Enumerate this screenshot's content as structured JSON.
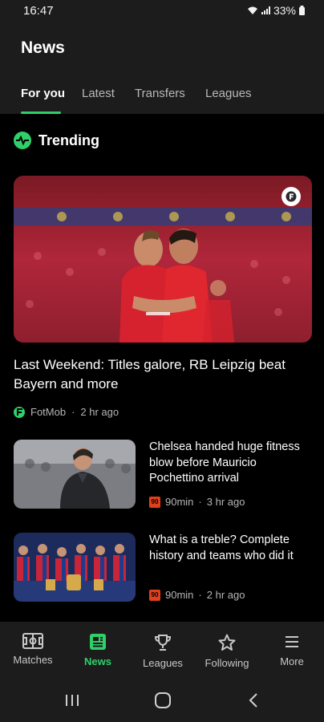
{
  "status_bar": {
    "time": "16:47",
    "battery": "33%"
  },
  "header": {
    "title": "News",
    "tabs": [
      {
        "label": "For you",
        "active": true
      },
      {
        "label": "Latest",
        "active": false
      },
      {
        "label": "Transfers",
        "active": false
      },
      {
        "label": "Leagues",
        "active": false
      }
    ]
  },
  "trending": {
    "label": "Trending",
    "icon": "pulse-icon"
  },
  "hero": {
    "title": "Last Weekend: Titles galore, RB Leipzig beat Bayern and more",
    "source": "FotMob",
    "time": "2 hr ago",
    "badge_icon": "fotmob-logo-icon"
  },
  "articles": [
    {
      "title": "Chelsea handed huge fitness blow before Mauricio Pochettino arrival",
      "source": "90min",
      "time": "3 hr ago"
    },
    {
      "title": "What is a treble? Complete history and teams who did it",
      "source": "90min",
      "time": "2 hr ago"
    }
  ],
  "meta_separator": "·",
  "source_logos": {
    "fotmob": "F",
    "ninety": "90"
  },
  "bottom_nav": [
    {
      "label": "Matches",
      "icon": "pitch-icon",
      "active": false
    },
    {
      "label": "News",
      "icon": "news-icon",
      "active": true
    },
    {
      "label": "Leagues",
      "icon": "trophy-icon",
      "active": false
    },
    {
      "label": "Following",
      "icon": "star-icon",
      "active": false
    },
    {
      "label": "More",
      "icon": "menu-icon",
      "active": false
    }
  ],
  "colors": {
    "accent": "#2fd06a",
    "background": "#000000",
    "surface": "#1c1c1c",
    "ninety_min_brand": "#e0401c"
  }
}
